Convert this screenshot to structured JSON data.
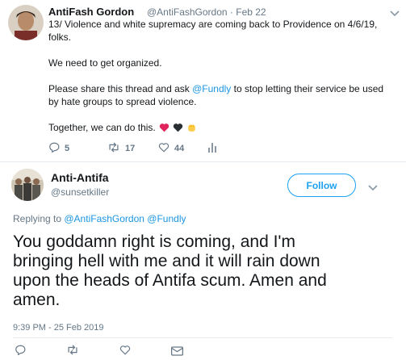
{
  "tweet1": {
    "name": "AntiFash Gordon",
    "handle": "@AntiFashGordon",
    "separator": "·",
    "date": "Feb 22",
    "line1": "13/ Violence and white supremacy are coming back to Providence on 4/6/19,",
    "line2": "folks.",
    "para2": "We need to get organized.",
    "para3_pre": "Please share this thread and ask ",
    "para3_mention": "@Fundly",
    "para3_post": " to stop letting their service be used",
    "para3_line2": "by hate groups to spread violence.",
    "para4": "Together, we can do this.",
    "emoji_hearts": [
      "❤",
      "🖤",
      "💛"
    ],
    "replies": "5",
    "retweets": "17",
    "likes": "44"
  },
  "tweet2": {
    "name": "Anti-Antifa",
    "handle": "@sunsetkiller",
    "follow_label": "Follow",
    "replying_prefix": "Replying to ",
    "replying_to_1": "@AntiFashGordon",
    "replying_to_2": "@Fundly",
    "text_line1": "You goddamn right is coming, and I'm",
    "text_line2": "bringing hell with me and it will rain down",
    "text_line3": "upon the heads of Antifa scum. Amen and",
    "text_line4": "amen.",
    "timestamp": "9:39 PM - 25 Feb 2019"
  },
  "colors": {
    "accent": "#1da1f2",
    "link": "#1b95e0",
    "secondary_text": "#657786",
    "divider": "#e6ecf0",
    "heart_red": "#e0245e"
  }
}
